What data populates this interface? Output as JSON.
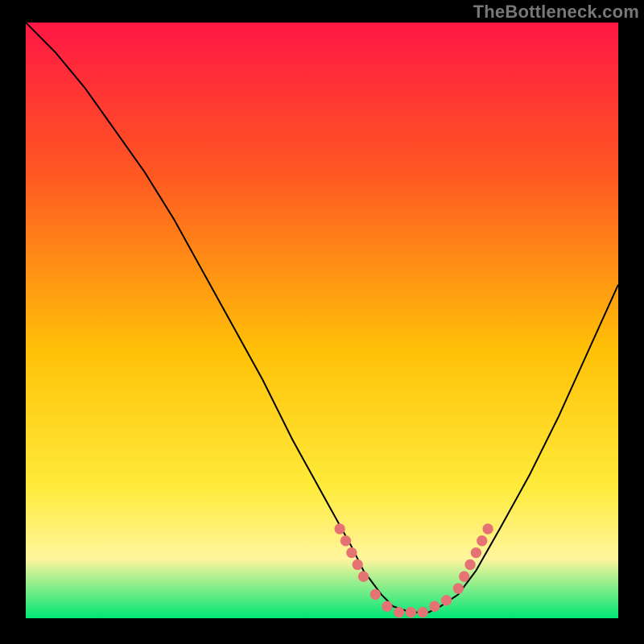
{
  "watermark": "TheBottleneck.com",
  "colors": {
    "black": "#000000",
    "frame_black": "#000000",
    "watermark_gray": "#777777",
    "curve_black": "#000000",
    "dot_red": "#e57373",
    "grad_top": "#ff1744",
    "grad_upper_mid": "#ff5722",
    "grad_mid": "#ffc107",
    "grad_lower_mid": "#ffeb3b",
    "grad_pale": "#fff59d",
    "grad_green": "#00e676"
  },
  "chart_data": {
    "type": "line",
    "title": "",
    "xlabel": "",
    "ylabel": "",
    "xlim": [
      0,
      100
    ],
    "ylim": [
      0,
      100
    ],
    "series": [
      {
        "name": "bottleneck-curve",
        "x": [
          0,
          5,
          10,
          15,
          20,
          25,
          30,
          35,
          40,
          45,
          50,
          55,
          57,
          60,
          62,
          65,
          68,
          70,
          73,
          76,
          80,
          85,
          90,
          95,
          100
        ],
        "y": [
          100,
          95,
          89,
          82,
          75,
          67,
          58,
          49,
          40,
          30,
          21,
          12,
          8,
          4,
          2,
          1,
          1,
          2,
          4,
          8,
          15,
          24,
          34,
          45,
          56
        ]
      }
    ],
    "dots": {
      "name": "highlight-dots",
      "points": [
        {
          "x": 53,
          "y": 15
        },
        {
          "x": 54,
          "y": 13
        },
        {
          "x": 55,
          "y": 11
        },
        {
          "x": 56,
          "y": 9
        },
        {
          "x": 57,
          "y": 7
        },
        {
          "x": 59,
          "y": 4
        },
        {
          "x": 61,
          "y": 2
        },
        {
          "x": 63,
          "y": 1
        },
        {
          "x": 65,
          "y": 1
        },
        {
          "x": 67,
          "y": 1
        },
        {
          "x": 69,
          "y": 2
        },
        {
          "x": 71,
          "y": 3
        },
        {
          "x": 73,
          "y": 5
        },
        {
          "x": 74,
          "y": 7
        },
        {
          "x": 75,
          "y": 9
        },
        {
          "x": 76,
          "y": 11
        },
        {
          "x": 77,
          "y": 13
        },
        {
          "x": 78,
          "y": 15
        }
      ]
    },
    "gradient_stops": [
      {
        "offset": 0.0,
        "color_key": "grad_top"
      },
      {
        "offset": 0.25,
        "color_key": "grad_upper_mid"
      },
      {
        "offset": 0.55,
        "color_key": "grad_mid"
      },
      {
        "offset": 0.78,
        "color_key": "grad_lower_mid"
      },
      {
        "offset": 0.9,
        "color_key": "grad_pale"
      },
      {
        "offset": 1.0,
        "color_key": "grad_green"
      }
    ]
  }
}
